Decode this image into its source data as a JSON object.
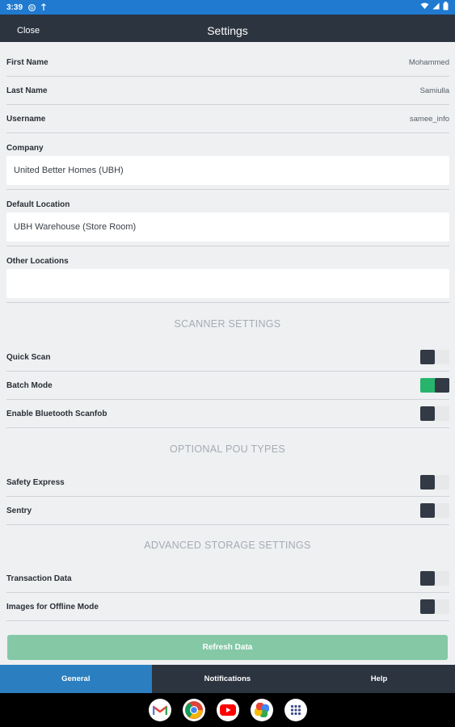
{
  "status_bar": {
    "time": "3:39"
  },
  "header": {
    "close_label": "Close",
    "title": "Settings"
  },
  "profile": {
    "first_name": {
      "label": "First Name",
      "value": "Mohammed"
    },
    "last_name": {
      "label": "Last Name",
      "value": "Samiulla"
    },
    "username": {
      "label": "Username",
      "value": "samee_info"
    }
  },
  "company": {
    "label": "Company",
    "value": "United Better Homes (UBH)"
  },
  "default_location": {
    "label": "Default Location",
    "value": "UBH Warehouse (Store Room)"
  },
  "other_locations": {
    "label": "Other Locations",
    "value": ""
  },
  "sections": {
    "scanner": "SCANNER SETTINGS",
    "pou": "OPTIONAL POU TYPES",
    "storage": "ADVANCED STORAGE SETTINGS"
  },
  "toggles": {
    "quick_scan": {
      "label": "Quick Scan",
      "on": false
    },
    "batch_mode": {
      "label": "Batch Mode",
      "on": true
    },
    "bluetooth": {
      "label": "Enable Bluetooth Scanfob",
      "on": false
    },
    "safety_express": {
      "label": "Safety Express",
      "on": false
    },
    "sentry": {
      "label": "Sentry",
      "on": false
    },
    "transaction_data": {
      "label": "Transaction Data",
      "on": false
    },
    "images_offline": {
      "label": "Images for Offline Mode",
      "on": false
    }
  },
  "refresh_label": "Refresh Data",
  "tabs": [
    "General",
    "Notifications",
    "Help"
  ],
  "colors": {
    "accent": "#2b7fc0",
    "toggle_on": "#27b46d",
    "header": "#2c3440"
  },
  "dock_apps": [
    "gmail-icon",
    "chrome-icon",
    "youtube-icon",
    "photos-icon",
    "app-drawer-icon"
  ]
}
